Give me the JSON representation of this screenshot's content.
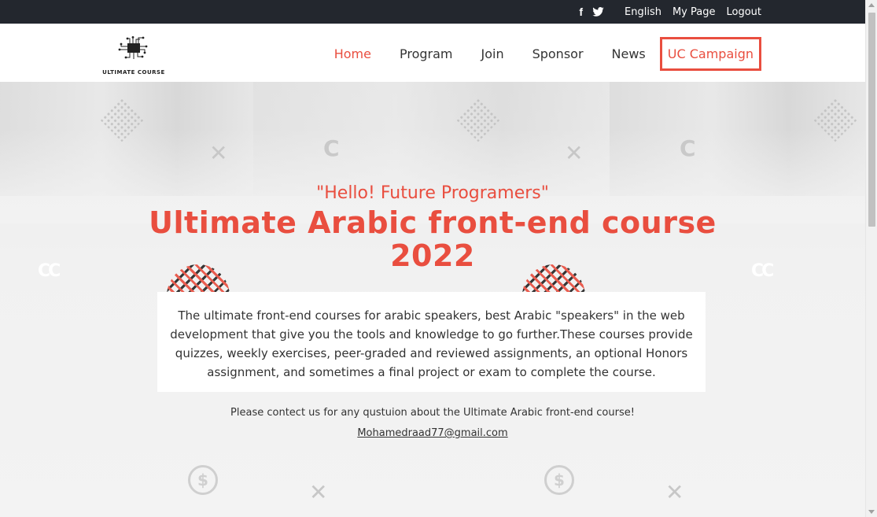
{
  "topbar": {
    "facebook_icon": "f",
    "links": {
      "english": "English",
      "mypage": "My Page",
      "logout": "Logout"
    }
  },
  "header": {
    "logo_text": "ULTIMATE COURSE",
    "nav": {
      "home": "Home",
      "program": "Program",
      "join": "Join",
      "sponsor": "Sponsor",
      "news": "News",
      "campaign": "UC Campaign"
    }
  },
  "hero": {
    "subtitle": "\"Hello! Future Programers\"",
    "title_line1": "Ultimate Arabic front-end course",
    "title_line2": "2022",
    "description": "The ultimate front-end courses for arabic speakers, best Arabic \"speakers\" in the web development that give you the tools and knowledge to go further.These courses provide quizzes, weekly exercises, peer-graded and reviewed assignments, an optional Honors assignment, and sometimes a final project or exam to complete the course.",
    "contact_text": "Please contect us for any qustuion about the Ultimate Arabic front-end course!",
    "email": "Mohamedraad77@gmail.com"
  },
  "colors": {
    "accent": "#e94e3f",
    "topbar": "#23272e"
  }
}
